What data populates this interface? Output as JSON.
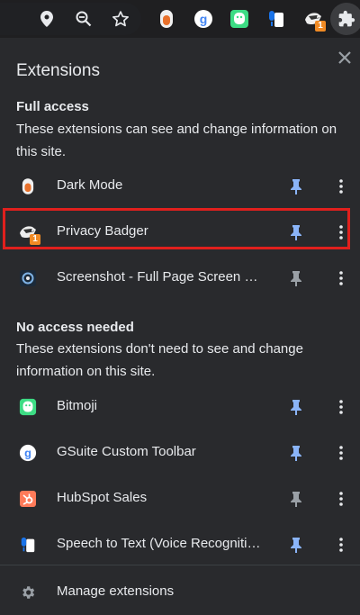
{
  "panel": {
    "title": "Extensions"
  },
  "full_access": {
    "heading": "Full access",
    "description": "These extensions can see and change information on this site.",
    "items": [
      {
        "label": "Dark Mode",
        "pinned": true
      },
      {
        "label": "Privacy Badger",
        "pinned": true,
        "badge": "1",
        "highlighted": true
      },
      {
        "label": "Screenshot - Full Page Screen Capture",
        "pinned": false
      }
    ]
  },
  "no_access": {
    "heading": "No access needed",
    "description": "These extensions don't need to see and change information on this site.",
    "items": [
      {
        "label": "Bitmoji",
        "pinned": true
      },
      {
        "label": "GSuite Custom Toolbar",
        "pinned": true
      },
      {
        "label": "HubSpot Sales",
        "pinned": false
      },
      {
        "label": "Speech to Text (Voice Recognition)",
        "pinned": true
      }
    ]
  },
  "footer": {
    "manage_label": "Manage extensions"
  },
  "toolbar": {
    "privacy_badger_badge": "1"
  },
  "colors": {
    "pinned": "#8ab4f8",
    "unpinned": "#9aa0a6",
    "highlight": "#e0201d"
  }
}
